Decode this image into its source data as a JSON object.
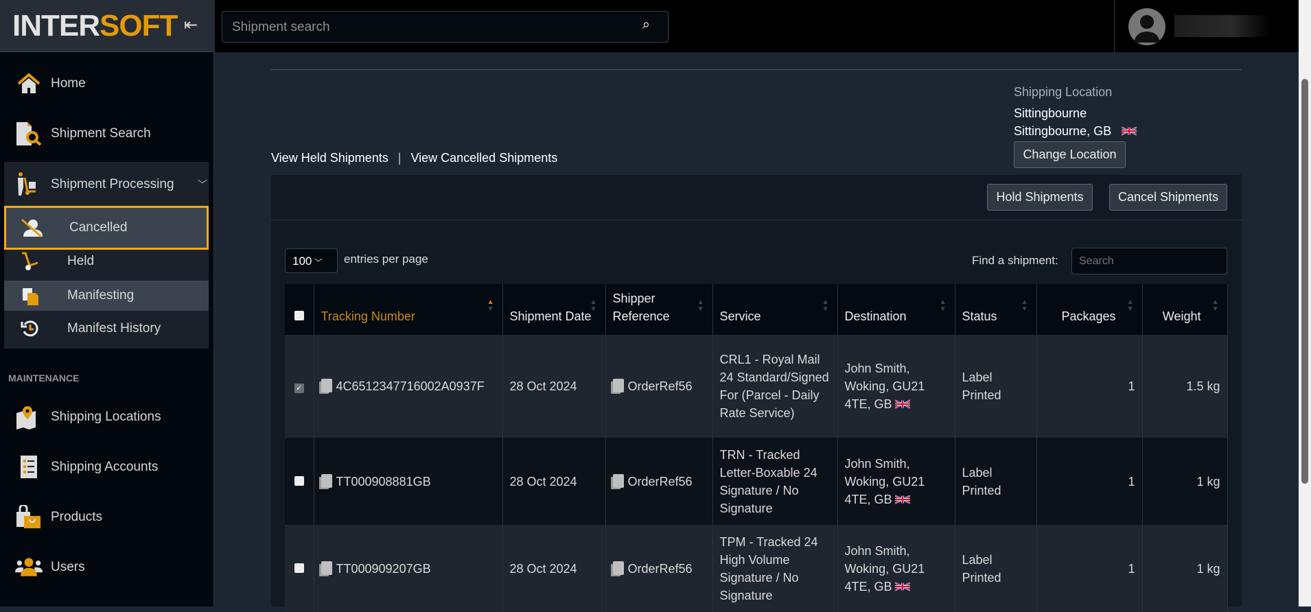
{
  "brand": {
    "logo_left": "INTER",
    "logo_right": "SOFT",
    "accent": "#e39a0e"
  },
  "search": {
    "placeholder": "Shipment search"
  },
  "sidebar": {
    "items": [
      {
        "label": "Home",
        "icon": "home-icon"
      },
      {
        "label": "Shipment Search",
        "icon": "document-search-icon"
      }
    ],
    "group": {
      "label": "Shipment Processing",
      "icon": "hand-truck-icon",
      "children": [
        {
          "label": "Cancelled",
          "icon": "cancelled-user-icon",
          "active": true
        },
        {
          "label": "Held",
          "icon": "dolly-icon"
        },
        {
          "label": "Manifesting",
          "icon": "clipboard-icon"
        },
        {
          "label": "Manifest History",
          "icon": "history-icon"
        }
      ]
    },
    "section": "MAINTENANCE",
    "maintenance": [
      {
        "label": "Shipping Locations",
        "icon": "map-pin-icon"
      },
      {
        "label": "Shipping Accounts",
        "icon": "list-icon"
      },
      {
        "label": "Products",
        "icon": "bag-icon"
      },
      {
        "label": "Users",
        "icon": "users-icon"
      }
    ]
  },
  "location": {
    "heading": "Shipping Location",
    "name": "Sittingbourne",
    "address": "Sittingbourne, GB",
    "change_label": "Change Location"
  },
  "links": {
    "held": "View Held Shipments",
    "sep": "|",
    "cancelled": "View Cancelled Shipments"
  },
  "toolbar": {
    "hold": "Hold Shipments",
    "cancel": "Cancel Shipments"
  },
  "table_controls": {
    "per_page": "100",
    "per_page_label": "entries per page",
    "find_label": "Find a shipment:",
    "find_placeholder": "Search"
  },
  "columns": [
    "Tracking Number",
    "Shipment Date",
    "Shipper Reference",
    "Service",
    "Destination",
    "Status",
    "Packages",
    "Weight"
  ],
  "rows": [
    {
      "checked": true,
      "tracking": "4C6512347716002A0937F",
      "date": "28 Oct 2024",
      "ref": "OrderRef56",
      "service": "CRL1 - Royal Mail 24 Standard/Signed For (Parcel - Daily Rate Service)",
      "dest": "John Smith, Woking, GU21 4TE, GB",
      "status": "Label Printed",
      "packages": "1",
      "weight": "1.5 kg"
    },
    {
      "checked": false,
      "tracking": "TT000908881GB",
      "date": "28 Oct 2024",
      "ref": "OrderRef56",
      "service": "TRN - Tracked Letter-Boxable 24 Signature / No Signature",
      "dest": "John Smith, Woking, GU21 4TE, GB",
      "status": "Label Printed",
      "packages": "1",
      "weight": "1 kg"
    },
    {
      "checked": false,
      "tracking": "TT000909207GB",
      "date": "28 Oct 2024",
      "ref": "OrderRef56",
      "service": "TPM - Tracked 24 High Volume Signature / No Signature",
      "dest": "John Smith, Woking, GU21 4TE, GB",
      "status": "Label Printed",
      "packages": "1",
      "weight": "1 kg"
    }
  ]
}
